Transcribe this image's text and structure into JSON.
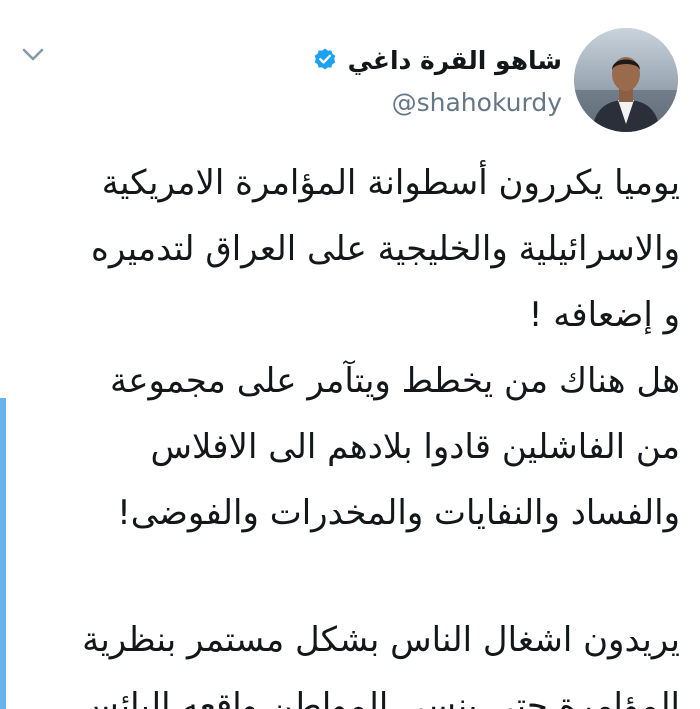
{
  "colors": {
    "accent": "#1da1f2",
    "text": "#14171a",
    "secondary": "#657786",
    "left_bar": "#67b5ea"
  },
  "header": {
    "display_name": "شاهو القرة داغي",
    "handle": "@shahokurdy",
    "verified_icon": "verified-badge-icon",
    "menu_icon": "chevron-down-icon",
    "avatar_icon": "avatar"
  },
  "tweet": {
    "lines": [
      "يوميا يكررون أسطوانة المؤامرة الامريكية",
      "والاسرائيلية والخليجية على العراق لتدميره",
      "و إضعافه !",
      "هل هناك من يخطط ويتآمر على مجموعة",
      "من الفاشلين قادوا بلادهم الى الافلاس",
      "والفساد والنفايات والمخدرات والفوضى!",
      "يريدون اشغال الناس بشكل مستمر بنظرية",
      "المؤامرة حتي ينسى المواطن واقعه البائس"
    ]
  }
}
